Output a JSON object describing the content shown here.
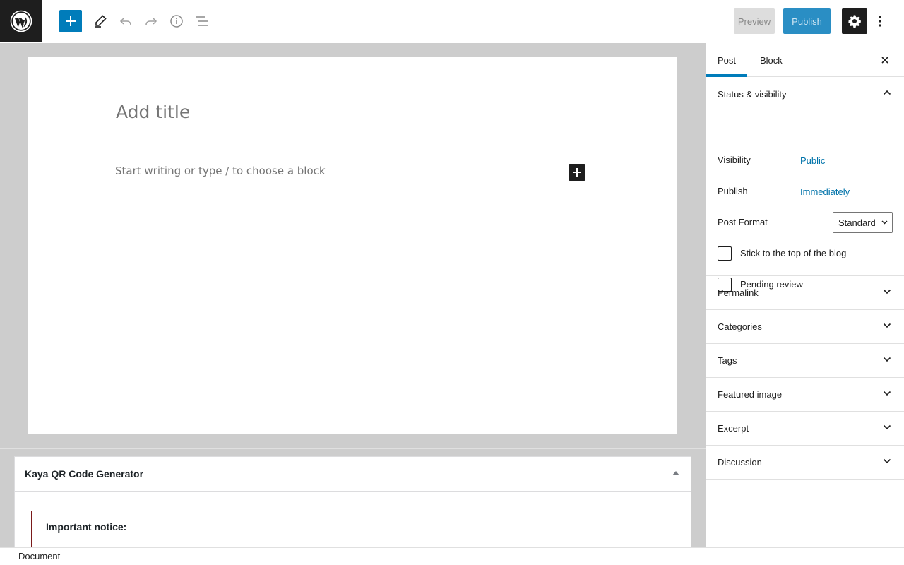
{
  "topbar": {
    "logo": "wordpress-logo",
    "add_block_icon": "plus-icon",
    "tools_icon": "pencil-icon",
    "undo_icon": "undo-icon",
    "redo_icon": "redo-icon",
    "details_icon": "info-icon",
    "outline_icon": "list-view-icon",
    "preview_label": "Preview",
    "publish_label": "Publish",
    "settings_icon": "gear-icon",
    "more_icon": "vertical-ellipsis-icon"
  },
  "editor": {
    "title_placeholder": "Add title",
    "paragraph_placeholder": "Start writing or type / to choose a block",
    "inline_add_icon": "plus-icon"
  },
  "metabox": {
    "title": "Kaya QR Code Generator",
    "notice_heading": "Important notice:"
  },
  "footer": {
    "breadcrumb": "Document"
  },
  "sidebar": {
    "tabs": [
      {
        "label": "Post",
        "active": true
      },
      {
        "label": "Block",
        "active": false
      }
    ],
    "status_panel": {
      "title": "Status & visibility",
      "visibility_label": "Visibility",
      "visibility_value": "Public",
      "publish_label": "Publish",
      "publish_value": "Immediately",
      "format_label": "Post Format",
      "format_value": "Standard",
      "sticky_label": "Stick to the top of the blog",
      "sticky_checked": false,
      "pending_label": "Pending review",
      "pending_checked": false
    },
    "panels": [
      {
        "title": "Permalink"
      },
      {
        "title": "Categories"
      },
      {
        "title": "Tags"
      },
      {
        "title": "Featured image"
      },
      {
        "title": "Excerpt"
      },
      {
        "title": "Discussion"
      }
    ]
  },
  "colors": {
    "accent": "#007cba",
    "link": "#0073aa",
    "dark": "#1e1e1e",
    "canvas_bg": "#cdcdcd"
  }
}
